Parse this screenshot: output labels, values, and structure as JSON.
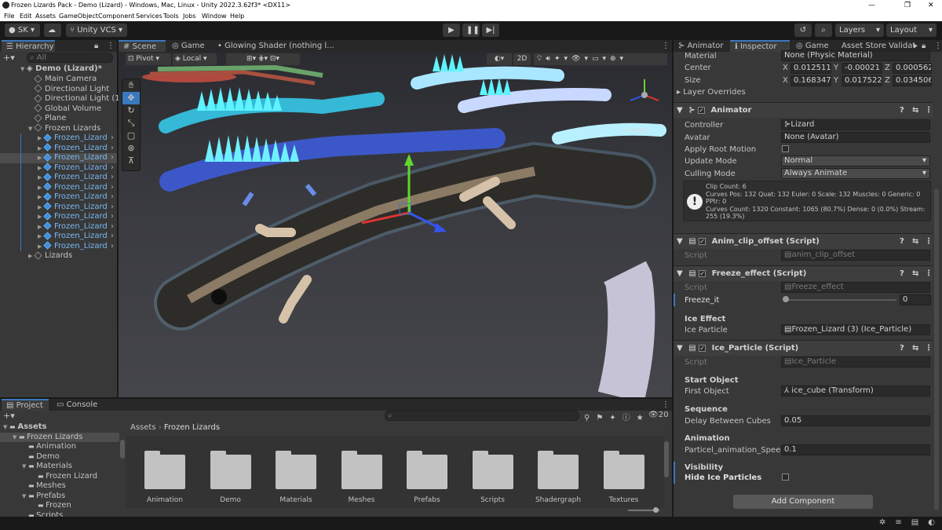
{
  "window": {
    "title": "Frozen Lizards Pack - Demo (Lizard) - Windows, Mac, Linux - Unity 2022.3.62f3* <DX11>",
    "minimize": "—",
    "maximize": "❐",
    "close": "✕"
  },
  "menu": [
    "File",
    "Edit",
    "Assets",
    "GameObject",
    "Component",
    "Services",
    "Tools",
    "Jobs",
    "Window",
    "Help"
  ],
  "toolbar": {
    "account": "SK",
    "vcs": "Unity VCS",
    "layers": "Layers",
    "layout": "Layout"
  },
  "hierarchy": {
    "tab": "Hierarchy",
    "search_placeholder": "All",
    "scene": "Demo (Lizard)*",
    "items": [
      {
        "label": "Main Camera",
        "type": "obj"
      },
      {
        "label": "Directional Light",
        "type": "obj"
      },
      {
        "label": "Directional Light (1)",
        "type": "obj"
      },
      {
        "label": "Global Volume",
        "type": "obj"
      },
      {
        "label": "Plane",
        "type": "obj"
      },
      {
        "label": "Frozen Lizards",
        "type": "obj"
      },
      {
        "label": "Frozen_Lizard",
        "type": "prefab"
      },
      {
        "label": "Frozen_Lizard",
        "type": "prefab"
      },
      {
        "label": "Frozen_Lizard",
        "type": "prefab",
        "selected": true
      },
      {
        "label": "Frozen_Lizard",
        "type": "prefab"
      },
      {
        "label": "Frozen_Lizard",
        "type": "prefab"
      },
      {
        "label": "Frozen_Lizard",
        "type": "prefab"
      },
      {
        "label": "Frozen_Lizard",
        "type": "prefab"
      },
      {
        "label": "Frozen_Lizard",
        "type": "prefab"
      },
      {
        "label": "Frozen_Lizard",
        "type": "prefab"
      },
      {
        "label": "Frozen_Lizard",
        "type": "prefab"
      },
      {
        "label": "Frozen_Lizard",
        "type": "prefab"
      },
      {
        "label": "Frozen_Lizard",
        "type": "prefab"
      },
      {
        "label": "Lizards",
        "type": "obj"
      }
    ]
  },
  "scene_view": {
    "tabs": [
      "Scene",
      "Game",
      "Glowing Shader (nothing l..."
    ],
    "pivot": "Pivot",
    "local": "Local",
    "mode_2d": "2D",
    "persp": "< Persp"
  },
  "inspector": {
    "tabs": [
      "Animator",
      "Inspector",
      "Game",
      "Asset Store Validato"
    ],
    "material_label": "Material",
    "material_value": "None (Physic Material)",
    "center_label": "Center",
    "center": {
      "x": "0.0125116",
      "y": "-0.00021",
      "z": "0.000562"
    },
    "size_label": "Size",
    "size": {
      "x": "0.1683471",
      "y": "0.0175227",
      "z": "0.034506"
    },
    "layer_overrides": "Layer Overrides",
    "animator": {
      "title": "Animator",
      "controller_label": "Controller",
      "controller": "Lizard",
      "avatar_label": "Avatar",
      "avatar": "None (Avatar)",
      "root_motion": "Apply Root Motion",
      "update_mode_label": "Update Mode",
      "update_mode": "Normal",
      "culling_label": "Culling Mode",
      "culling": "Always Animate",
      "info": [
        "Clip Count: 6",
        "Curves Pos: 132 Quat: 132 Euler: 0 Scale: 132 Muscles: 0 Generic: 0",
        "PPtr: 0",
        "Curves Count: 1320 Constant: 1065 (80.7%) Dense: 0 (0.0%) Stream:",
        "255 (19.3%)"
      ]
    },
    "anim_clip": {
      "title": "Anim_clip_offset (Script)",
      "script_label": "Script",
      "script": "anim_clip_offset"
    },
    "freeze": {
      "title": "Freeze_effect (Script)",
      "script_label": "Script",
      "script": "Freeze_effect",
      "freeze_label": "Freeze_it",
      "freeze_value": "0",
      "ice_effect": "Ice Effect",
      "ice_particle_label": "Ice Particle",
      "ice_particle": "Frozen_Lizard (3) (Ice_Particle)"
    },
    "ice_particle": {
      "title": "Ice_Particle (Script)",
      "script_label": "Script",
      "script": "Ice_Particle",
      "start_object": "Start Object",
      "first_object_label": "First Object",
      "first_object": "ice_cube (Transform)",
      "sequence": "Sequence",
      "delay_label": "Delay Between Cubes",
      "delay": "0.05",
      "animation": "Animation",
      "speed_label": "Particel_animation_Speed",
      "speed": "0.1",
      "visibility": "Visibility",
      "hide_label": "Hide Ice Particles"
    },
    "add_component": "Add Component"
  },
  "project": {
    "tabs": [
      "Project",
      "Console"
    ],
    "count": "20",
    "breadcrumb": [
      "Assets",
      "Frozen Lizards"
    ],
    "tree": [
      {
        "label": "Assets",
        "indent": 0,
        "bold": true
      },
      {
        "label": "Frozen Lizards",
        "indent": 1,
        "sel": true
      },
      {
        "label": "Animation",
        "indent": 2
      },
      {
        "label": "Demo",
        "indent": 2
      },
      {
        "label": "Materials",
        "indent": 2
      },
      {
        "label": "Frozen Lizard",
        "indent": 3
      },
      {
        "label": "Meshes",
        "indent": 2
      },
      {
        "label": "Prefabs",
        "indent": 2
      },
      {
        "label": "Frozen",
        "indent": 3
      },
      {
        "label": "Scripts",
        "indent": 2
      }
    ],
    "folders": [
      "Animation",
      "Demo",
      "Materials",
      "Meshes",
      "Prefabs",
      "Scripts",
      "Shadergraph",
      "Textures"
    ]
  },
  "colors": {
    "accent": "#3a79bb",
    "prefab_blue": "#7bb8f5",
    "panel": "#383838"
  }
}
